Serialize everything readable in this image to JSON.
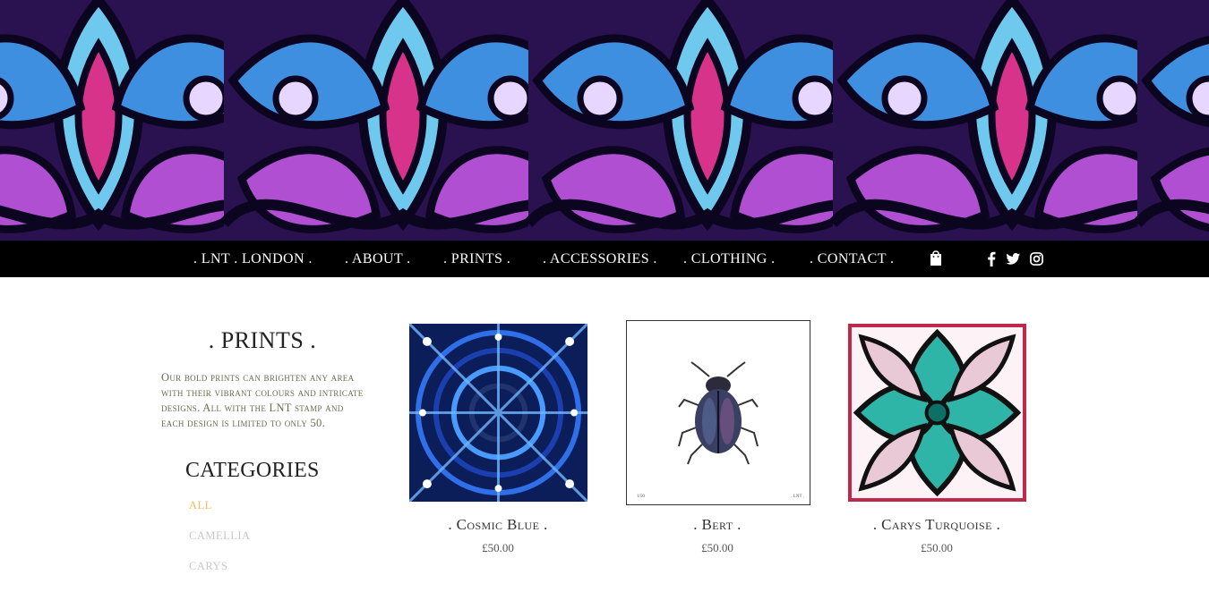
{
  "nav": {
    "items": [
      ". LNT . LONDON .",
      ". ABOUT .",
      ". PRINTS .",
      ". ACCESSORIES .",
      ". CLOTHING .",
      ". CONTACT ."
    ],
    "cart_icon": "shopping-bag-icon",
    "social_icons": [
      "facebook-icon",
      "twitter-icon",
      "instagram-icon"
    ]
  },
  "sidebar": {
    "title": ". PRINTS .",
    "description": "Our bold prints can brighten any area with their vibrant colours and intricate designs. All with the LNT stamp and each design is limited to only 50.",
    "categories_title": "CATEGORIES",
    "categories": [
      "ALL",
      "CAMELLIA",
      "CARYS"
    ],
    "active_category_color": "#f0c060"
  },
  "products": [
    {
      "name": ". Cosmic Blue .",
      "price": "£50.00"
    },
    {
      "name": ". Bert .",
      "price": "£50.00",
      "edition": "1/50",
      "stamp": ". LNT ."
    },
    {
      "name": ". Carys Turquoise .",
      "price": "£50.00"
    }
  ],
  "colors": {
    "nav_bg": "#000000",
    "text": "#222222"
  }
}
